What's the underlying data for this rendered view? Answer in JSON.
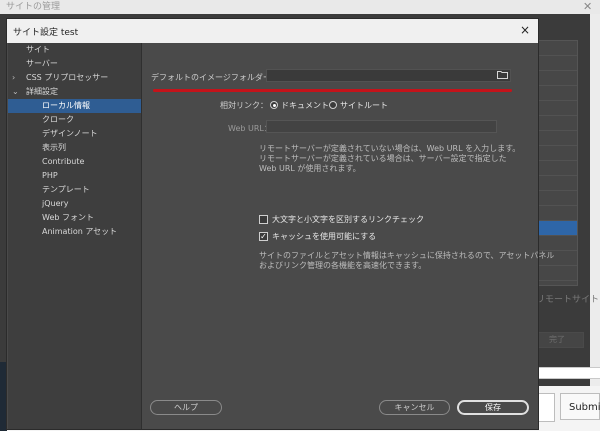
{
  "background_window": {
    "title": "サイトの管理",
    "remote_label": "リモートサイト",
    "done_label": "完了",
    "submit_label": "Submit"
  },
  "dialog": {
    "title": "サイト設定 test",
    "close_icon": "×"
  },
  "sidebar": {
    "items": [
      {
        "label": "サイト"
      },
      {
        "label": "サーバー"
      },
      {
        "label": "CSS プリプロセッサー",
        "arrow": "›"
      },
      {
        "label": "詳細設定",
        "arrow": "⌄"
      },
      {
        "label": "ローカル情報"
      },
      {
        "label": "クローク"
      },
      {
        "label": "デザインノート"
      },
      {
        "label": "表示列"
      },
      {
        "label": "Contribute"
      },
      {
        "label": "PHP"
      },
      {
        "label": "テンプレート"
      },
      {
        "label": "jQuery"
      },
      {
        "label": "Web フォント"
      },
      {
        "label": "Animation アセット"
      }
    ]
  },
  "form": {
    "default_image_folder_label": "デフォルトのイメージフォルダー：",
    "default_image_folder_value": "",
    "folder_icon": "folder-icon",
    "relative_link_label": "相対リンク：",
    "radio_document": "ドキュメント",
    "radio_site_root": "サイトルート",
    "web_url_label": "Web URL：",
    "web_url_value": "",
    "note1_line1": "リモートサーバーが定義されていない場合は、Web URL を入力します。",
    "note1_line2": "リモートサーバーが定義されている場合は、サーバー設定で指定した",
    "note1_line3": "Web URL が使用されます。",
    "checkbox_case_label": "大文字と小文字を区別するリンクチェック",
    "checkbox_cache_label": "キャッシュを使用可能にする",
    "note2_line1": "サイトのファイルとアセット情報はキャッシュに保持されるので、アセットパネル",
    "note2_line2": "およびリンク管理の各機能を高速化できます。"
  },
  "buttons": {
    "help": "ヘルプ",
    "cancel": "キャンセル",
    "save": "保存"
  },
  "colors": {
    "accent_selection": "#2f5d93",
    "highlight_underline": "#c4131a"
  }
}
